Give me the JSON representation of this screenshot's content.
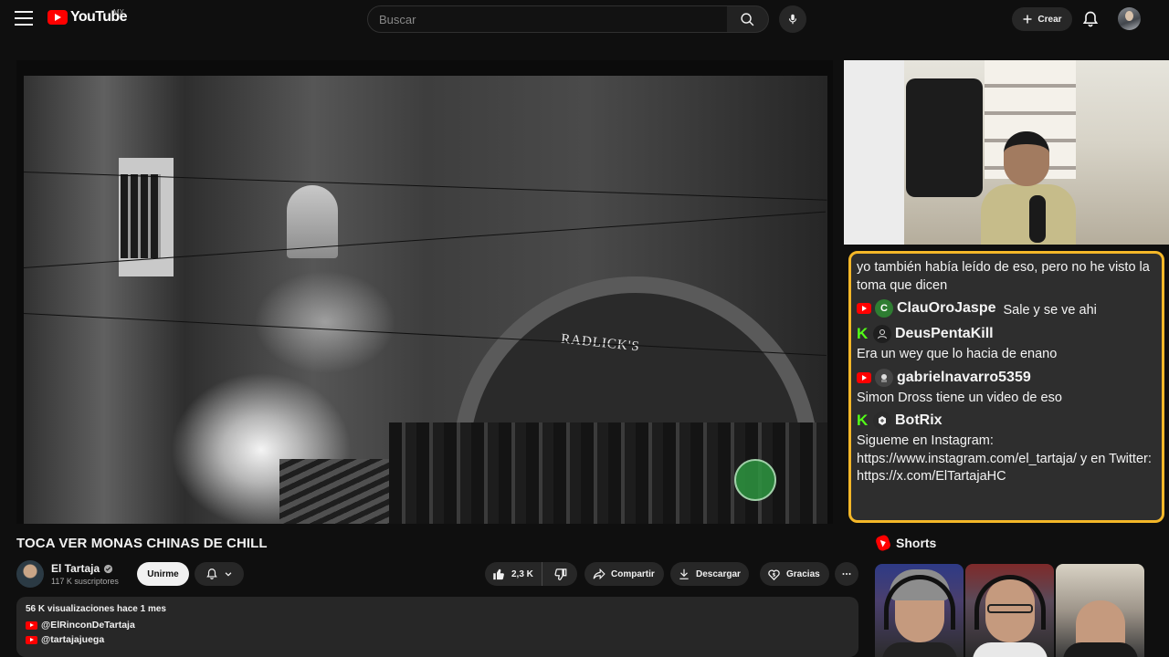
{
  "header": {
    "logo_text": "YouTube",
    "country_code": "MX",
    "search_placeholder": "Buscar",
    "create_label": "Crear"
  },
  "video": {
    "scene_sign": "RADLICK'S",
    "title": "TOCA VER MONAS CHINAS DE CHILL",
    "channel_name": "El Tartaja",
    "subscribers": "117 K suscriptores",
    "join_label": "Unirme",
    "likes": "2,3 K",
    "share_label": "Compartir",
    "download_label": "Descargar",
    "thanks_label": "Gracias"
  },
  "chat": {
    "messages": [
      {
        "platform": "",
        "user": "",
        "text": "yo también había leído de eso, pero no he visto la toma que dicen"
      },
      {
        "platform": "youtube",
        "avatar_letter": "C",
        "avatar_color": "#2e7d32",
        "user": "ClauOroJaspe",
        "text": "Sale y se ve ahi"
      },
      {
        "platform": "kick",
        "avatar_letter": "",
        "avatar_color": "#1f1f1f",
        "user": "DeusPentaKill",
        "text": "Era un wey que lo hacia de enano"
      },
      {
        "platform": "youtube",
        "avatar_letter": "",
        "avatar_color": "#444444",
        "user": "gabrielnavarro5359",
        "text": "Simon Dross tiene un video de eso"
      },
      {
        "platform": "kick",
        "avatar_letter": "",
        "avatar_color": "#2b2b2b",
        "user": "BotRix",
        "text": "Sigueme en Instagram: https://www.instagram.com/el_tartaja/ y en Twitter: https://x.com/ElTartajaHC"
      }
    ],
    "border_color": "#f4b728"
  },
  "description": {
    "meta": "56 K visualizaciones  hace 1 mes",
    "links": [
      "@ElRinconDeTartaja",
      "@tartajajuega"
    ]
  },
  "shorts": {
    "title": "Shorts"
  },
  "colors": {
    "brand_red": "#ff0000",
    "kick_green": "#53fc18",
    "background": "#0f0f0f"
  }
}
